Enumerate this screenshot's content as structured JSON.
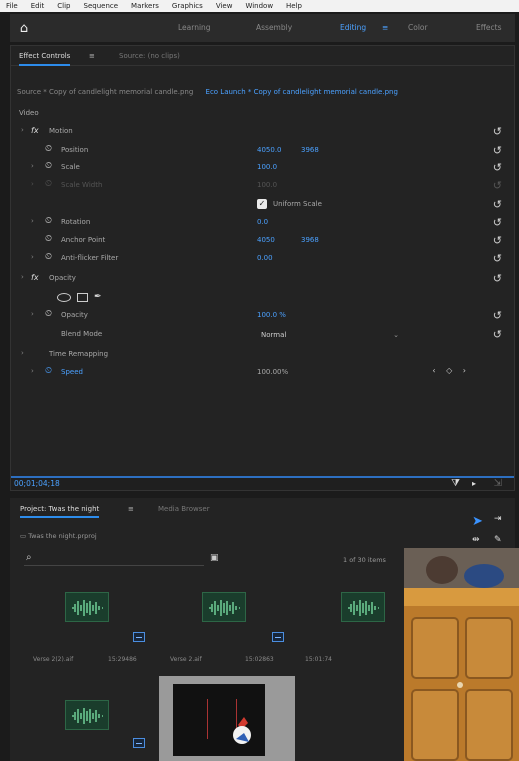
{
  "menubar": {
    "items": [
      "File",
      "Edit",
      "Clip",
      "Sequence",
      "Markers",
      "Graphics",
      "View",
      "Window",
      "Help"
    ]
  },
  "workspace": {
    "home_icon": "home-icon",
    "tabs": [
      {
        "label": "Learning",
        "active": false
      },
      {
        "label": "Assembly",
        "active": false
      },
      {
        "label": "Editing",
        "active": true
      },
      {
        "label": "Color",
        "active": false
      },
      {
        "label": "Effects",
        "active": false
      }
    ],
    "menu_glyph": "≡"
  },
  "effect_controls": {
    "tab_active": "Effect Controls",
    "tab_close": "≡",
    "tab_other": "Source: (no clips)",
    "source_label": "Source * Copy of candlelight memorial candle.png",
    "source_clip": "Eco Launch * Copy of candlelight memorial candle.png",
    "video_header": "Video",
    "motion": "Motion",
    "position_label": "Position",
    "position_x": "4050.0",
    "position_y": "3968",
    "scale_label": "Scale",
    "scale_value": "100.0",
    "scale_width_label": "Scale Width",
    "scale_width_value": "100.0",
    "uniform_scale": "Uniform Scale",
    "rotation_label": "Rotation",
    "rotation_value": "0.0",
    "anchor_label": "Anchor Point",
    "anchor_x": "4050",
    "anchor_y": "3968",
    "flicker_label": "Anti-flicker Filter",
    "flicker_value": "0.00",
    "opacity": "Opacity",
    "opacity_label": "Opacity",
    "opacity_value": "100.0 %",
    "blend_label": "Blend Mode",
    "blend_value": "Normal",
    "time_remap": "Time Remapping",
    "speed_label": "Speed",
    "speed_value": "100.00%",
    "timecode": "00;01;04;18"
  },
  "project": {
    "tab_active": "Project: Twas the night",
    "tab_close": "≡",
    "tab_other": "Media Browser",
    "breadcrumb": "Twas the night.prproj",
    "items_count": "1 of 30 items",
    "clips": [
      {
        "name": "Verse 2(2).aif",
        "dur": "15:29486"
      },
      {
        "name": "Verse 2.aif",
        "dur": "15:02863"
      },
      {
        "name": "",
        "dur": "15:01:74"
      }
    ]
  }
}
